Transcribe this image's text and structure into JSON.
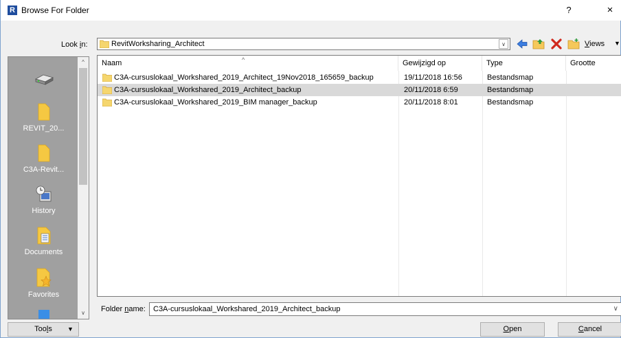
{
  "window": {
    "title": "Browse For Folder",
    "app_icon_letter": "R",
    "help_label": "?",
    "close_label": "×"
  },
  "lookin": {
    "label_pre": "Look ",
    "label_u": "i",
    "label_post": "n:",
    "value": "RevitWorksharing_Architect"
  },
  "toolbar": {
    "views_u": "V",
    "views_rest": "iews"
  },
  "places": [
    {
      "label": "",
      "icon": "drive-icon"
    },
    {
      "label": "REVIT_20...",
      "icon": "folder-icon"
    },
    {
      "label": "C3A-Revit...",
      "icon": "folder-icon"
    },
    {
      "label": "History",
      "icon": "history-icon"
    },
    {
      "label": "Documents",
      "icon": "documents-icon"
    },
    {
      "label": "Favorites",
      "icon": "favorites-icon"
    }
  ],
  "columns": [
    "Naam",
    "Gewijzigd op",
    "Type",
    "Grootte"
  ],
  "files": [
    {
      "name": "C3A-cursuslokaal_Workshared_2019_Architect_19Nov2018_165659_backup",
      "modified": "19/11/2018 16:56",
      "type": "Bestandsmap",
      "size": ""
    },
    {
      "name": "C3A-cursuslokaal_Workshared_2019_Architect_backup",
      "modified": "20/11/2018 6:59",
      "type": "Bestandsmap",
      "size": ""
    },
    {
      "name": "C3A-cursuslokaal_Workshared_2019_BIM manager_backup",
      "modified": "20/11/2018 8:01",
      "type": "Bestandsmap",
      "size": ""
    }
  ],
  "selected_index": 1,
  "foldername": {
    "label_pre": "Folder ",
    "label_u": "n",
    "label_post": "ame:",
    "value": "C3A-cursuslokaal_Workshared_2019_Architect_backup"
  },
  "buttons": {
    "tools_pre": "Too",
    "tools_u": "l",
    "tools_post": "s",
    "open_u": "O",
    "open_rest": "pen",
    "cancel_u": "C",
    "cancel_rest": "ancel"
  },
  "colors": {
    "places_bg": "#a0a0a0",
    "selected_row": "#d9d9d9",
    "folder_yellow": "#f5d66e"
  }
}
